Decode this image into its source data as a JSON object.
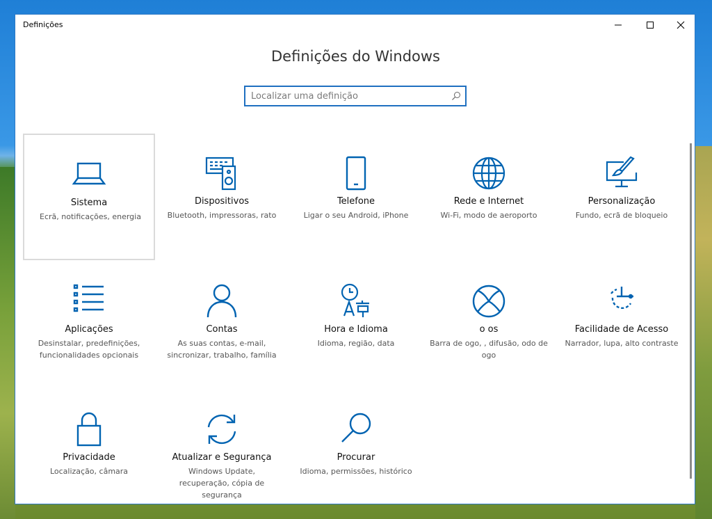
{
  "window": {
    "title": "Definições"
  },
  "header": {
    "title": "Definições do Windows"
  },
  "search": {
    "placeholder": "Localizar uma definição"
  },
  "colors": {
    "accent": "#0063B1",
    "border": "#1e6fc0"
  },
  "tiles": [
    {
      "name": "Sistema",
      "desc": "Ecrã, notificações, energia",
      "icon": "laptop-icon"
    },
    {
      "name": "Dispositivos",
      "desc": "Bluetooth, impressoras, rato",
      "icon": "devices-icon"
    },
    {
      "name": "Telefone",
      "desc": "Ligar o seu Android, iPhone",
      "icon": "phone-icon"
    },
    {
      "name": "Rede e Internet",
      "desc": "Wi-Fi, modo de aeroporto",
      "icon": "globe-icon"
    },
    {
      "name": "Personalização",
      "desc": "Fundo, ecrã de bloqueio",
      "icon": "paint-icon"
    },
    {
      "name": "Aplicações",
      "desc": "Desinstalar, predefinições, funcionalidades opcionais",
      "icon": "apps-list-icon"
    },
    {
      "name": "Contas",
      "desc": "As suas contas, e-mail, sincronizar, trabalho, família",
      "icon": "person-icon"
    },
    {
      "name": "Hora e Idioma",
      "desc": "Idioma, região, data",
      "icon": "time-language-icon"
    },
    {
      "name": "o os",
      "desc": "Barra de ogo, , difusão, odo de ogo",
      "icon": "xbox-icon"
    },
    {
      "name": "Facilidade de Acesso",
      "desc": "Narrador, lupa, alto contraste",
      "icon": "ease-of-access-icon"
    },
    {
      "name": "Privacidade",
      "desc": "Localização, câmara",
      "icon": "lock-icon"
    },
    {
      "name": "Atualizar e Segurança",
      "desc": "Windows Update, recuperação, cópia de segurança",
      "icon": "sync-icon"
    },
    {
      "name": "Procurar",
      "desc": "Idioma, permissões, histórico",
      "icon": "magnifier-icon"
    }
  ]
}
